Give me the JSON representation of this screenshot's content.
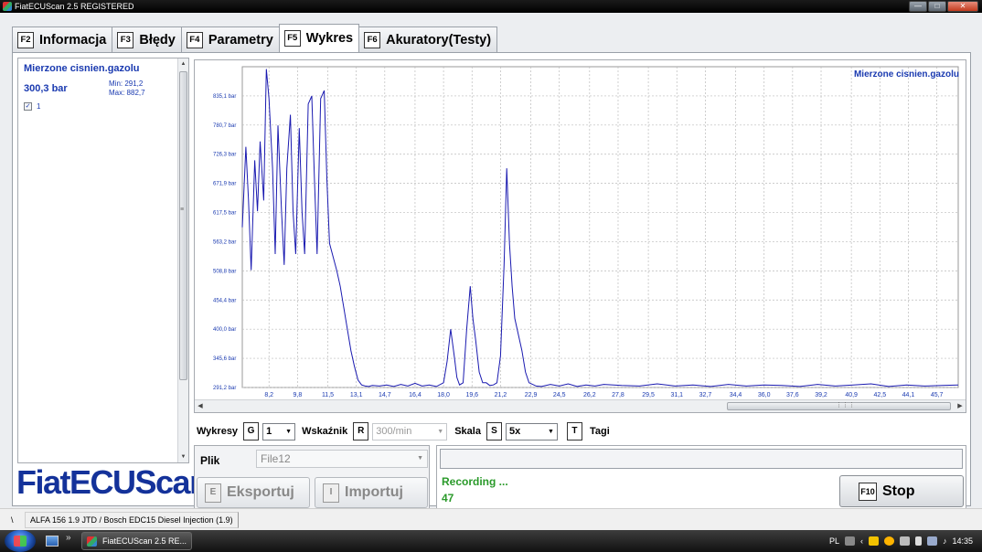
{
  "window": {
    "title": "FiatECUScan 2.5 REGISTERED"
  },
  "tabs": [
    {
      "key": "F2",
      "label": "Informacja"
    },
    {
      "key": "F3",
      "label": "Błędy"
    },
    {
      "key": "F4",
      "label": "Parametry"
    },
    {
      "key": "F5",
      "label": "Wykres"
    },
    {
      "key": "F6",
      "label": "Akuratory(Testy)"
    }
  ],
  "active_tab": "F5",
  "left_panel": {
    "param_name": "Mierzone cisnien.gazolu",
    "value": "300,3 bar",
    "min": "Min: 291,2",
    "max": "Max: 882,7",
    "series_label": "1",
    "checked": true
  },
  "logo": "FiatECUScan",
  "chart_data": {
    "type": "line",
    "legend": "Mierzone cisnien.gazolu",
    "legend_position": "top-right",
    "grid": true,
    "color": "#1a1ab0",
    "y_ticks": [
      "291,2 bar",
      "345,6 bar",
      "400,0 bar",
      "454,4 bar",
      "508,8 bar",
      "563,2 bar",
      "617,5 bar",
      "671,9 bar",
      "726,3 bar",
      "780,7 bar",
      "835,1 bar"
    ],
    "x_ticks": [
      "8,2",
      "9,8",
      "11,5",
      "13,1",
      "14,7",
      "16,4",
      "18,0",
      "19,6",
      "21,2",
      "22,9",
      "24,5",
      "26,2",
      "27,8",
      "29,5",
      "31,1",
      "32,7",
      "34,4",
      "36,0",
      "37,6",
      "39,2",
      "40,9",
      "42,5",
      "44,1",
      "45,7"
    ],
    "ylim": [
      291.2,
      889.5
    ],
    "xlim": [
      6.7,
      46.9
    ],
    "x": [
      6.7,
      6.9,
      7.05,
      7.2,
      7.4,
      7.55,
      7.7,
      7.9,
      8.05,
      8.2,
      8.4,
      8.55,
      8.7,
      8.9,
      9.05,
      9.2,
      9.4,
      9.55,
      9.7,
      9.9,
      10.05,
      10.2,
      10.4,
      10.6,
      10.75,
      10.9,
      11.1,
      11.3,
      11.45,
      11.6,
      11.8,
      12.0,
      12.2,
      12.4,
      12.6,
      12.8,
      13.0,
      13.2,
      13.4,
      13.6,
      13.8,
      14.0,
      14.4,
      14.8,
      15.2,
      15.6,
      16.0,
      16.4,
      16.8,
      17.2,
      17.6,
      18.0,
      18.2,
      18.4,
      18.6,
      18.75,
      18.9,
      19.1,
      19.3,
      19.5,
      19.65,
      19.8,
      20.0,
      20.2,
      20.4,
      20.6,
      20.8,
      21.0,
      21.2,
      21.4,
      21.55,
      21.7,
      21.85,
      22.0,
      22.2,
      22.4,
      22.6,
      22.8,
      23.0,
      23.2,
      23.5,
      24.0,
      24.5,
      25.0,
      25.5,
      26.0,
      26.5,
      27.0,
      28.0,
      29.0,
      30.0,
      31.0,
      32.0,
      33.0,
      34.0,
      35.0,
      36.0,
      37.0,
      38.0,
      39.0,
      40.0,
      41.0,
      42.0,
      43.0,
      44.0,
      45.0,
      46.0,
      46.9
    ],
    "y": [
      590,
      740,
      640,
      510,
      715,
      620,
      750,
      640,
      885,
      830,
      700,
      540,
      780,
      620,
      520,
      700,
      800,
      620,
      540,
      775,
      620,
      540,
      820,
      835,
      680,
      540,
      830,
      845,
      680,
      560,
      535,
      510,
      480,
      440,
      400,
      360,
      330,
      305,
      296,
      294,
      293,
      295,
      294,
      296,
      293,
      297,
      294,
      299,
      294,
      296,
      293,
      300,
      340,
      400,
      350,
      310,
      296,
      300,
      400,
      480,
      420,
      380,
      320,
      300,
      300,
      295,
      296,
      300,
      350,
      520,
      700,
      560,
      480,
      420,
      390,
      360,
      320,
      300,
      297,
      294,
      293,
      297,
      294,
      298,
      293,
      296,
      294,
      297,
      295,
      294,
      298,
      294,
      296,
      293,
      297,
      294,
      296,
      295,
      293,
      297,
      294,
      296,
      298,
      293,
      296,
      294,
      295,
      296
    ]
  },
  "controls": {
    "wykresy_label": "Wykresy",
    "wykresy_key": "G",
    "wykresy_value": "1",
    "wskaznik_label": "Wskaźnik",
    "wskaznik_key": "R",
    "wskaznik_value": "300/min",
    "skala_label": "Skala",
    "skala_key": "S",
    "skala_value": "5x",
    "tagi_key": "T",
    "tagi_label": "Tagi"
  },
  "file": {
    "label": "Plik",
    "value": "File12",
    "export_key": "E",
    "export_label": "Eksportuj",
    "import_key": "I",
    "import_label": "Importuj"
  },
  "recording": {
    "status": "Recording ...",
    "count": "47",
    "stop_key": "F10",
    "stop_label": "Stop"
  },
  "statusbar": {
    "slash": "\\",
    "car": "ALFA 156 1.9 JTD / Bosch EDC15 Diesel Injection (1.9)"
  },
  "taskbar": {
    "more": "»",
    "item": "FiatECUScan 2.5 RE...",
    "lang": "PL",
    "clock": "14:35"
  }
}
